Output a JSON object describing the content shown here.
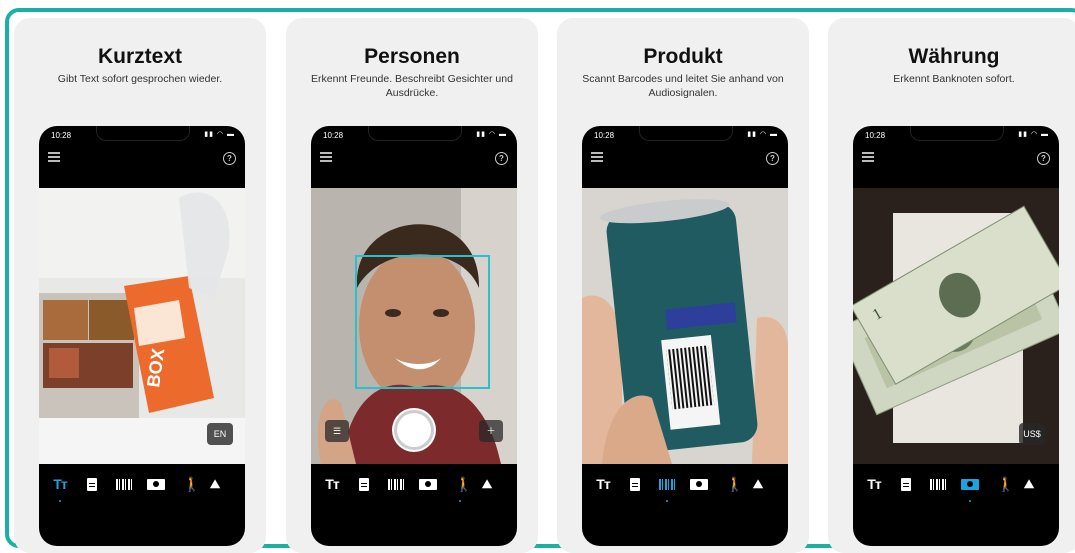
{
  "cards": [
    {
      "title": "Kurztext",
      "subtitle": "Gibt Text sofort gesprochen wieder.",
      "time": "10:28",
      "chip": "EN",
      "active_mode": 0
    },
    {
      "title": "Personen",
      "subtitle": "Erkennt Freunde. Beschreibt Gesichter und Ausdrücke.",
      "time": "10:28",
      "active_mode": 4
    },
    {
      "title": "Produkt",
      "subtitle": "Scannt Barcodes und leitet Sie anhand von Audiosignalen.",
      "time": "10:28",
      "active_mode": 2
    },
    {
      "title": "Währung",
      "subtitle": "Erkennt Banknoten sofort.",
      "time": "10:28",
      "chip": "US$",
      "active_mode": 3
    }
  ],
  "modes": [
    "short-text",
    "document",
    "barcode",
    "currency",
    "person",
    "scene"
  ],
  "mode_glyphs": {
    "short_text": "Tт",
    "person": "🚶",
    "scene": "⛰"
  },
  "colors": {
    "frame": "#1ab0a6",
    "accent": "#1aa3df",
    "face_box": "#27c1d0"
  }
}
